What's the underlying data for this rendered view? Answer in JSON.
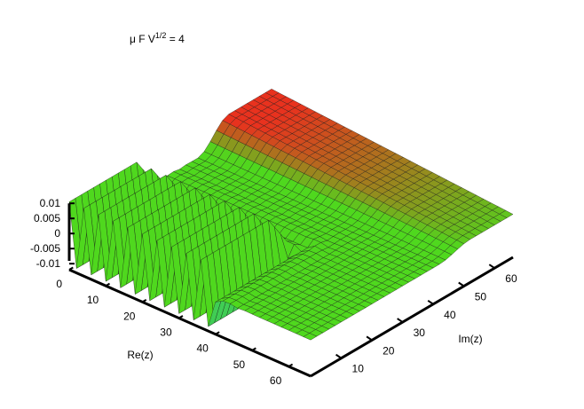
{
  "chart_data": {
    "type": "surface",
    "title": {
      "prefix": "μ F V",
      "superscript": "1/2",
      "suffix": " = 4"
    },
    "xlabel": "Re(z)",
    "ylabel": "Im(z)",
    "zlabel": "",
    "xlim": [
      0,
      66
    ],
    "ylim": [
      0,
      66
    ],
    "zlim": [
      -0.012,
      0.01
    ],
    "x_ticks": [
      "0",
      "10",
      "20",
      "30",
      "40",
      "50",
      "60"
    ],
    "y_ticks": [
      "10",
      "20",
      "30",
      "40",
      "50",
      "60"
    ],
    "z_ticks": [
      "0.01",
      "0.005",
      "0",
      "-0.005",
      "-0.01"
    ],
    "grid": false,
    "legend": "none",
    "surface": {
      "description_values": {
        "plateau_value": 0.0,
        "oscillation_amplitude": 0.0105,
        "oscillating_region_re_max": 38,
        "oscillating_region_im_max": 28,
        "ridge_step_re": 2,
        "sample_spacing": 2
      }
    },
    "colors": {
      "high": "#e8321e",
      "mid": "#4fd81e",
      "low": "#1e32c8",
      "axis": "#000000"
    }
  }
}
